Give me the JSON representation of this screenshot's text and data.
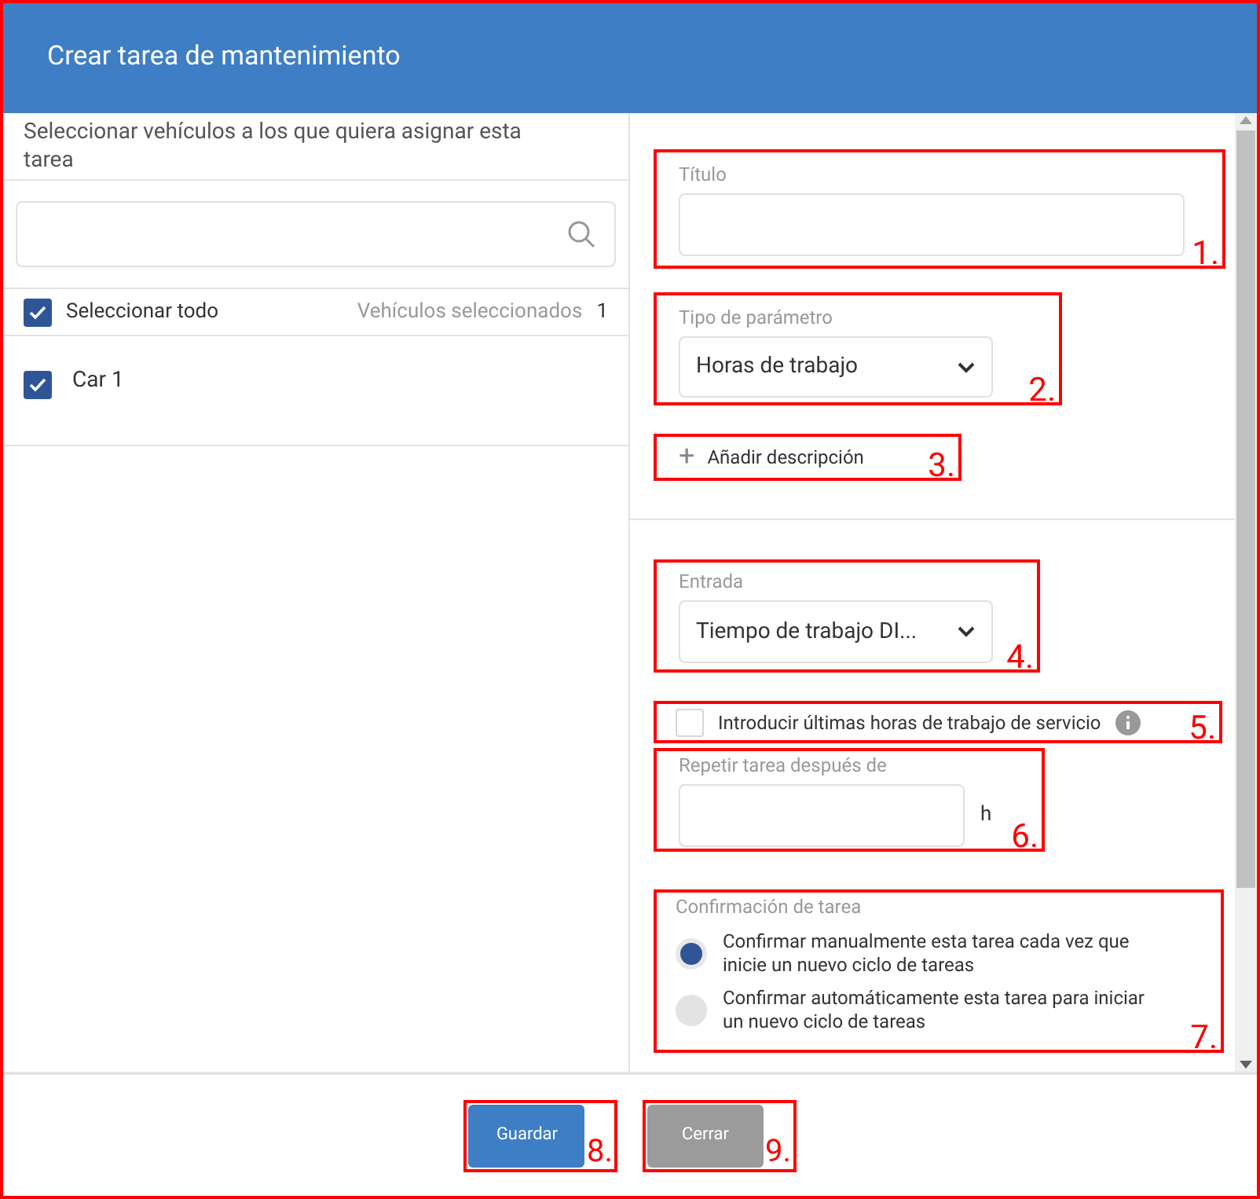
{
  "dialog": {
    "title": "Crear tarea de mantenimiento"
  },
  "vehicles_panel": {
    "instruction": "Seleccionar vehículos a los que quiera asignar esta tarea",
    "select_all": {
      "label": "Seleccionar todo",
      "checked": true,
      "selected_label": "Vehículos seleccionados",
      "selected_count": "1"
    },
    "vehicles": [
      {
        "name": "Car 1",
        "checked": true
      }
    ]
  },
  "form": {
    "title_field": {
      "label": "Título",
      "annotation": "1."
    },
    "parameter_type": {
      "label": "Tipo de parámetro",
      "value": "Horas de trabajo",
      "annotation": "2."
    },
    "add_description": {
      "icon": "+",
      "label": "Añadir descripción",
      "annotation": "3."
    },
    "input": {
      "label": "Entrada",
      "value": "Tiempo de trabajo DI...",
      "annotation": "4."
    },
    "last_hours": {
      "label": "Introducir últimas horas de trabajo de servicio",
      "checked": false,
      "annotation": "5."
    },
    "repeat": {
      "label": "Repetir tarea después de",
      "unit": "h",
      "annotation": "6."
    },
    "confirmation": {
      "label": "Confirmación de tarea",
      "annotation": "7.",
      "options": [
        {
          "label": "Confirmar manualmente esta tarea cada vez que inicie un nuevo ciclo de tareas",
          "selected": true
        },
        {
          "label": "Confirmar automáticamente esta tarea para iniciar un nuevo ciclo de tareas",
          "selected": false
        }
      ]
    }
  },
  "buttons": [
    {
      "label": "Guardar",
      "kind": "primary",
      "annotation": "8."
    },
    {
      "label": "Cerrar",
      "kind": "secondary",
      "annotation": "9."
    }
  ]
}
